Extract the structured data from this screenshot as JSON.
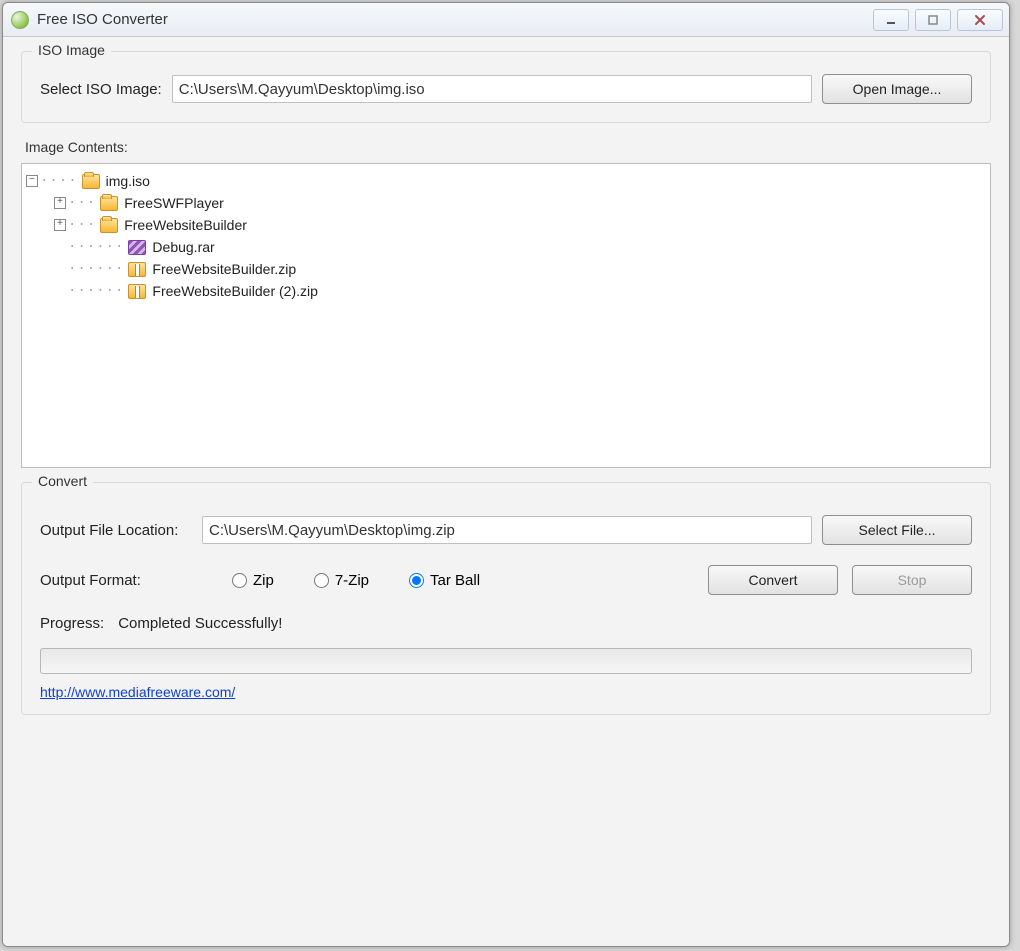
{
  "window": {
    "title": "Free ISO Converter"
  },
  "iso_image": {
    "legend": "ISO Image",
    "select_label": "Select ISO Image:",
    "path": "C:\\Users\\M.Qayyum\\Desktop\\img.iso",
    "open_btn": "Open Image..."
  },
  "contents": {
    "label": "Image Contents:",
    "tree": {
      "root": {
        "label": "img.iso",
        "icon": "folder"
      },
      "children": [
        {
          "label": "FreeSWFPlayer",
          "icon": "folder",
          "expandable": true
        },
        {
          "label": "FreeWebsiteBuilder",
          "icon": "folder",
          "expandable": true
        },
        {
          "label": "Debug.rar",
          "icon": "rar"
        },
        {
          "label": "FreeWebsiteBuilder.zip",
          "icon": "zip"
        },
        {
          "label": "FreeWebsiteBuilder (2).zip",
          "icon": "zip"
        }
      ]
    }
  },
  "convert": {
    "legend": "Convert",
    "output_label": "Output File Location:",
    "output_path": "C:\\Users\\M.Qayyum\\Desktop\\img.zip",
    "select_file_btn": "Select File...",
    "format_label": "Output Format:",
    "formats": {
      "zip": "Zip",
      "sevenzip": "7-Zip",
      "tarball": "Tar Ball",
      "selected": "tarball"
    },
    "convert_btn": "Convert",
    "stop_btn": "Stop",
    "progress_label": "Progress:",
    "progress_status": "Completed Successfully!"
  },
  "footer": {
    "link": "http://www.mediafreeware.com/"
  }
}
